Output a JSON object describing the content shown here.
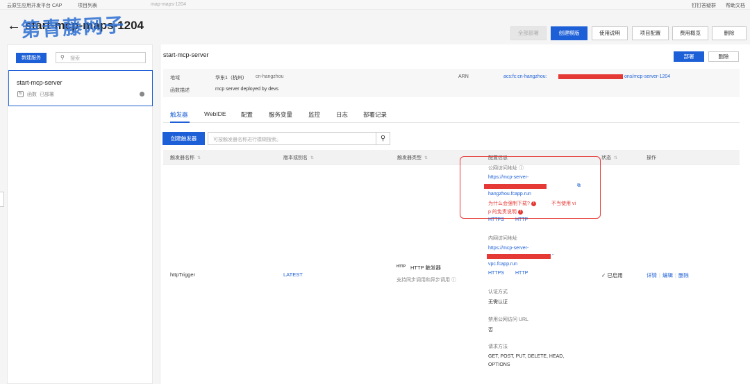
{
  "topbar": {
    "platform": "云原生应用开发平台 CAP",
    "project_list": "项目列表",
    "current_crumb": "map-maps-1204",
    "links": [
      "钉钉答疑群",
      "帮助文档"
    ]
  },
  "header": {
    "title": "start-mcp-maps-1204",
    "watermark": "第青藤网子",
    "buttons": [
      "全部部署",
      "创建模版",
      "使用说明",
      "项目配置",
      "费用概览",
      "删除"
    ]
  },
  "sidebar": {
    "new_service": "新建服务",
    "search_placeholder": "搜索",
    "service": {
      "name": "start-mcp-server",
      "type": "函数",
      "status": "已部署",
      "icon": "fx"
    }
  },
  "service": {
    "name": "start-mcp-server",
    "deploy": "部署",
    "delete": "删除",
    "info": {
      "region_label": "地域",
      "region_value": "华东1（杭州）",
      "region_code": "cn-hangzhou",
      "desc_label": "函数描述",
      "desc_value": "mcp server deployed by devs",
      "arn_label": "ARN",
      "arn_prefix": "acs:fc:cn-hangzhou:",
      "arn_suffix": "ons/mcp-server-1204"
    }
  },
  "tabs": [
    "触发器",
    "WebIDE",
    "配置",
    "服务变量",
    "监控",
    "日志",
    "部署记录"
  ],
  "triggers": {
    "create_button": "创建触发器",
    "search_placeholder": "可按触发器名称进行模糊搜索。",
    "columns": [
      "触发器名称",
      "版本或别名",
      "触发器类型",
      "配置信息",
      "状态",
      "操作"
    ],
    "row": {
      "name": "httpTrigger",
      "version": "LATEST",
      "type": "HTTP 触发器",
      "type_icon": "HTTP",
      "type_desc": "支持同步调用和异步调用",
      "status": "已启用",
      "actions": [
        "详情",
        "编辑",
        "删除"
      ],
      "config": {
        "public_label": "公网访问地址",
        "public_url_prefix": "https://mcp-server-",
        "public_url_suffix": "hangzhou.fcapp.run",
        "warn1": "为什么会强制下载?",
        "warn2": "不当使用 vi",
        "warn3": "p 的免责说明",
        "public_protocols": [
          "HTTPS",
          "HTTP"
        ],
        "private_label": "内网访问地址",
        "private_url_prefix": "https://mcp-server-",
        "private_url_suffix": "vpc.fcapp.run",
        "private_protocols": [
          "HTTPS",
          "HTTP"
        ],
        "auth_label": "认证方式",
        "auth_value": "无需认证",
        "disable_public_label": "禁用公网访问 URL",
        "disable_public_value": "否",
        "methods_label": "请求方法",
        "methods_line1": "GET, POST, PUT, DELETE, HEAD,",
        "methods_line2": "OPTIONS"
      }
    }
  }
}
